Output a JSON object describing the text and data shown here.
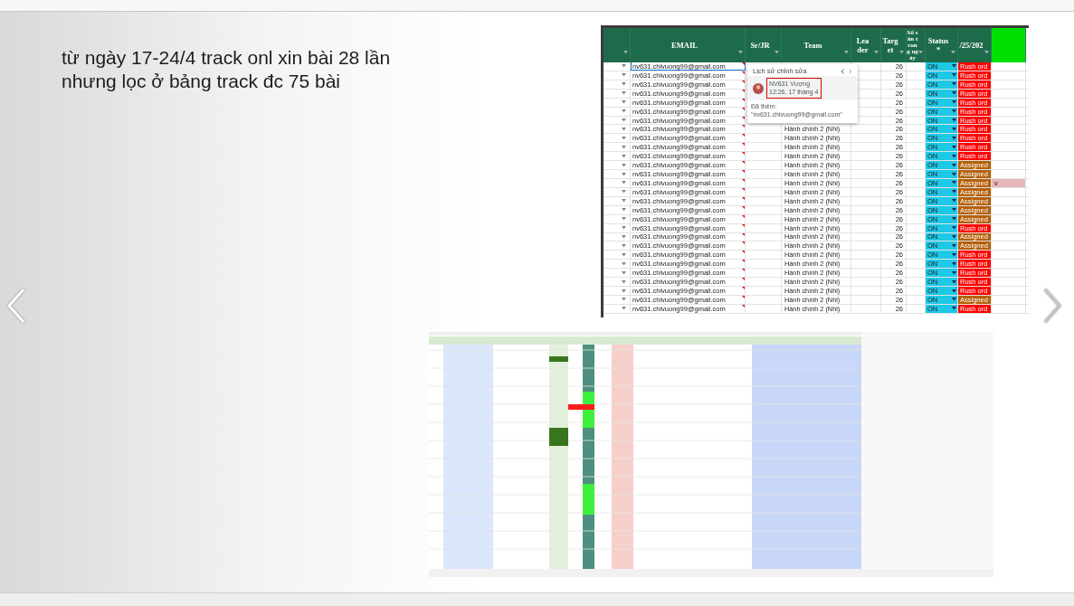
{
  "slide": {
    "note": "từ ngày 17-24/4 track onl xin bài 28 lần nhưng lọc ở bảng track đc 75 bài",
    "sheet": {
      "columns": [
        {
          "kind": "blank"
        },
        {
          "kind": "email",
          "label": "EMAIL"
        },
        {
          "kind": "text",
          "label": "Sr/JR"
        },
        {
          "kind": "text",
          "label": "Team"
        },
        {
          "kind": "narrow",
          "label": "Leader"
        },
        {
          "kind": "narrow",
          "label": "Target"
        },
        {
          "kind": "tiny",
          "label": "Số sản trong ngày"
        },
        {
          "kind": "text",
          "label": "Status *"
        },
        {
          "kind": "text",
          "label": "/25/202"
        },
        {
          "kind": "flag"
        }
      ],
      "rows": [
        {
          "email": "nv631.chivuong99@gmail.com",
          "target": "26",
          "status": "ON",
          "tag": "Rush ord",
          "kind": "rush",
          "selected": true
        },
        {
          "email": "nv631.chivuong99@gmail.com",
          "target": "26",
          "status": "ON",
          "tag": "Rush ord",
          "kind": "rush",
          "selected": false
        },
        {
          "email": "nv631.chivuong99@gmail.com",
          "target": "26",
          "status": "ON",
          "tag": "Rush ord",
          "kind": "rush",
          "selected": false
        },
        {
          "email": "nv631.chivuong99@gmail.com",
          "target": "26",
          "status": "ON",
          "tag": "Rush ord",
          "kind": "rush",
          "selected": false
        },
        {
          "email": "nv631.chivuong99@gmail.com",
          "target": "26",
          "status": "ON",
          "tag": "Rush ord",
          "kind": "rush",
          "selected": false
        },
        {
          "email": "nv631.chivuong99@gmail.com",
          "target": "26",
          "status": "ON",
          "tag": "Rush ord",
          "kind": "rush",
          "selected": false
        },
        {
          "email": "nv631.chivuong99@gmail.com",
          "target": "26",
          "status": "ON",
          "tag": "Rush ord",
          "kind": "rush",
          "selected": false
        },
        {
          "email": "nv631.chivuong99@gmail.com",
          "team": "Hành chính 2 (Nhi)",
          "target": "26",
          "status": "ON",
          "tag": "Rush ord",
          "kind": "rush",
          "selected": false
        },
        {
          "email": "nv631.chivuong99@gmail.com",
          "team": "Hành chính 2 (Nhi)",
          "target": "26",
          "status": "ON",
          "tag": "Rush ord",
          "kind": "rush",
          "selected": false
        },
        {
          "email": "nv631.chivuong99@gmail.com",
          "team": "Hành chính 2 (Nhi)",
          "target": "26",
          "status": "ON",
          "tag": "Rush ord",
          "kind": "rush",
          "selected": false
        },
        {
          "email": "nv631.chivuong99@gmail.com",
          "team": "Hành chính 2 (Nhi)",
          "target": "26",
          "status": "ON",
          "tag": "Rush ord",
          "kind": "rush",
          "selected": false
        },
        {
          "email": "nv631.chivuong99@gmail.com",
          "team": "Hành chính 2 (Nhi)",
          "target": "26",
          "status": "ON",
          "tag": "Assigned",
          "kind": "assigned",
          "selected": false
        },
        {
          "email": "nv631.chivuong99@gmail.com",
          "team": "Hành chính 2 (Nhi)",
          "target": "26",
          "status": "ON",
          "tag": "Assigned",
          "kind": "assigned",
          "selected": false
        },
        {
          "email": "nv631.chivuong99@gmail.com",
          "team": "Hành chính 2 (Nhi)",
          "target": "26",
          "status": "ON",
          "tag": "Assigned",
          "kind": "assigned",
          "extra": "v",
          "selected": false
        },
        {
          "email": "nv631.chivuong99@gmail.com",
          "team": "Hành chính 2 (Nhi)",
          "target": "26",
          "status": "ON",
          "tag": "Assigned",
          "kind": "assigned",
          "selected": false
        },
        {
          "email": "nv631.chivuong99@gmail.com",
          "team": "Hành chính 2 (Nhi)",
          "target": "26",
          "status": "ON",
          "tag": "Assigned",
          "kind": "assigned",
          "selected": false
        },
        {
          "email": "nv631.chivuong99@gmail.com",
          "team": "Hành chính 2 (Nhi)",
          "target": "26",
          "status": "ON",
          "tag": "Assigned",
          "kind": "assigned",
          "selected": false
        },
        {
          "email": "nv631.chivuong99@gmail.com",
          "team": "Hành chính 2 (Nhi)",
          "target": "26",
          "status": "ON",
          "tag": "Assigned",
          "kind": "assigned",
          "selected": false
        },
        {
          "email": "nv631.chivuong99@gmail.com",
          "team": "Hành chính 2 (Nhi)",
          "target": "26",
          "status": "ON",
          "tag": "Rush ord",
          "kind": "rush",
          "selected": false
        },
        {
          "email": "nv631.chivuong99@gmail.com",
          "team": "Hành chính 2 (Nhi)",
          "target": "26",
          "status": "ON",
          "tag": "Assigned",
          "kind": "assigned",
          "selected": false
        },
        {
          "email": "nv631.chivuong99@gmail.com",
          "team": "Hành chính 2 (Nhi)",
          "target": "26",
          "status": "ON",
          "tag": "Assigned",
          "kind": "assigned",
          "selected": false
        },
        {
          "email": "nv631.chivuong99@gmail.com",
          "team": "Hành chính 2 (Nhi)",
          "target": "26",
          "status": "ON",
          "tag": "Rush ord",
          "kind": "rush",
          "selected": false
        },
        {
          "email": "nv631.chivuong99@gmail.com",
          "team": "Hành chính 2 (Nhi)",
          "target": "26",
          "status": "ON",
          "tag": "Rush ord",
          "kind": "rush",
          "selected": false
        },
        {
          "email": "nv631.chivuong99@gmail.com",
          "team": "Hành chính 2 (Nhi)",
          "target": "26",
          "status": "ON",
          "tag": "Rush ord",
          "kind": "rush",
          "selected": false
        },
        {
          "email": "nv631.chivuong99@gmail.com",
          "team": "Hành chính 2 (Nhi)",
          "target": "26",
          "status": "ON",
          "tag": "Rush ord",
          "kind": "rush",
          "selected": false
        },
        {
          "email": "nv631.chivuong99@gmail.com",
          "team": "Hành chính 2 (Nhi)",
          "target": "26",
          "status": "ON",
          "tag": "Rush ord",
          "kind": "rush",
          "selected": false
        },
        {
          "email": "nv631.chivuong99@gmail.com",
          "team": "Hành chính 2 (Nhi)",
          "target": "26",
          "status": "ON",
          "tag": "Assigned",
          "kind": "assigned",
          "selected": false
        },
        {
          "email": "nv631.chivuong99@gmail.com",
          "team": "Hành chính 2 (Nhi)",
          "target": "26",
          "status": "ON",
          "tag": "Rush ord",
          "kind": "rush",
          "selected": false
        }
      ],
      "history_popup": {
        "title": "Lịch sử chỉnh sửa",
        "author": "NV631 Vượng",
        "time": "12:26, 17 tháng 4",
        "label": "Đã thêm:",
        "value": "\"nv631.chivuong99@gmail.com\""
      }
    }
  }
}
